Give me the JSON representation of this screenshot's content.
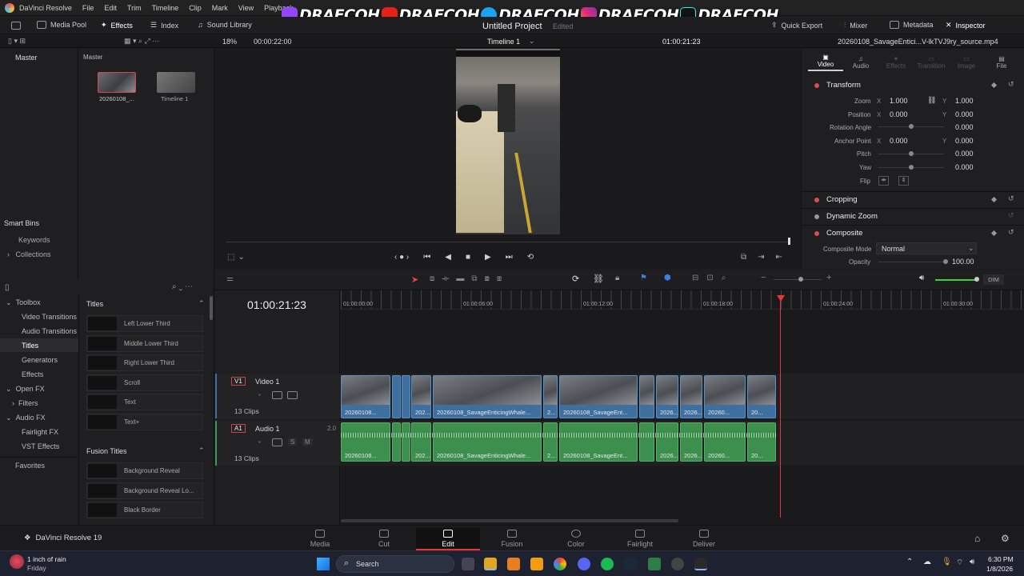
{
  "app": {
    "name": "DaVinci Resolve",
    "version_label": "DaVinci Resolve 19",
    "project": "Untitled Project",
    "project_status": "Edited"
  },
  "menu": [
    "DaVinci Resolve",
    "File",
    "Edit",
    "Trim",
    "Timeline",
    "Clip",
    "Mark",
    "View",
    "Playback"
  ],
  "overlay": {
    "handles": [
      "DRAECOH",
      "DRAECOH",
      "DRAECOH",
      "DRAECOH",
      "DRAECOH"
    ]
  },
  "toolbar": {
    "media_pool": "Media Pool",
    "effects": "Effects",
    "index": "Index",
    "sound_library": "Sound Library",
    "quick_export": "Quick Export",
    "mixer": "Mixer",
    "metadata": "Metadata",
    "inspector": "Inspector"
  },
  "viewer": {
    "zoom": "18%",
    "source_timecode": "00:00:22:00",
    "timeline_name": "Timeline 1",
    "timecode": "01:00:21:23",
    "clip_name": "20260108_SavageEntici...V-lkTVJ9ry_source.mp4"
  },
  "bins": {
    "master": "Master",
    "master_header": "Master",
    "smart_bins": "Smart Bins",
    "keywords": "Keywords",
    "collections": "Collections",
    "items": [
      {
        "label": "20260108_..."
      },
      {
        "label": "Timeline 1"
      }
    ]
  },
  "inspector": {
    "tabs": [
      "Video",
      "Audio",
      "Effects",
      "Transition",
      "Image",
      "File"
    ],
    "transform": "Transform",
    "zoom_label": "Zoom",
    "zoom_x": "1.000",
    "zoom_y": "1.000",
    "position_label": "Position",
    "position_x": "0.000",
    "position_y": "0.000",
    "rotation_label": "Rotation Angle",
    "rotation": "0.000",
    "anchor_label": "Anchor Point",
    "anchor_x": "0.000",
    "anchor_y": "0.000",
    "pitch_label": "Pitch",
    "pitch": "0.000",
    "yaw_label": "Yaw",
    "yaw": "0.000",
    "flip_label": "Flip",
    "cropping": "Cropping",
    "dynamic_zoom": "Dynamic Zoom",
    "composite": "Composite",
    "composite_mode_label": "Composite Mode",
    "composite_mode": "Normal",
    "opacity_label": "Opacity",
    "opacity": "100.00",
    "x": "X",
    "y": "Y"
  },
  "toolbox": {
    "root": "Toolbox",
    "items": [
      "Video Transitions",
      "Audio Transitions",
      "Titles",
      "Generators",
      "Effects"
    ],
    "open_fx": "Open FX",
    "filters": "Filters",
    "audio_fx": "Audio FX",
    "fairlight_fx": "Fairlight FX",
    "vst_effects": "VST Effects",
    "favorites": "Favorites",
    "titles_header": "Titles",
    "titles": [
      "Left Lower Third",
      "Middle Lower Third",
      "Right Lower Third",
      "Scroll",
      "Text",
      "Text+"
    ],
    "fusion_header": "Fusion Titles",
    "fusion_titles": [
      "Background Reveal",
      "Background Reveal Lo...",
      "Black Border"
    ]
  },
  "timeline": {
    "timecode": "01:00:21:23",
    "ruler": [
      "01:00:00:00",
      "01:00:06:00",
      "01:00:12:00",
      "01:00:18:00",
      "01:00:24:00",
      "01:00:30:00"
    ],
    "v1": {
      "id": "V1",
      "name": "Video 1",
      "clips": "13 Clips"
    },
    "a1": {
      "id": "A1",
      "name": "Audio 1",
      "clips": "13 Clips",
      "channels": "2.0",
      "solo": "S",
      "mute": "M"
    },
    "dim": "DIM",
    "clip_labels": [
      "20260108...",
      "202...",
      "20260108_SavageEnticingWhale...",
      "2...",
      "20260108_SavageEnt...",
      "2026...",
      "2026...",
      "20260...",
      "20..."
    ]
  },
  "pages": [
    "Media",
    "Cut",
    "Edit",
    "Fusion",
    "Color",
    "Fairlight",
    "Deliver"
  ],
  "active_page": "Edit",
  "taskbar": {
    "weather": "1 inch of rain",
    "day": "Friday",
    "search": "Search",
    "time": "6:30 PM",
    "date": "1/8/2026"
  }
}
